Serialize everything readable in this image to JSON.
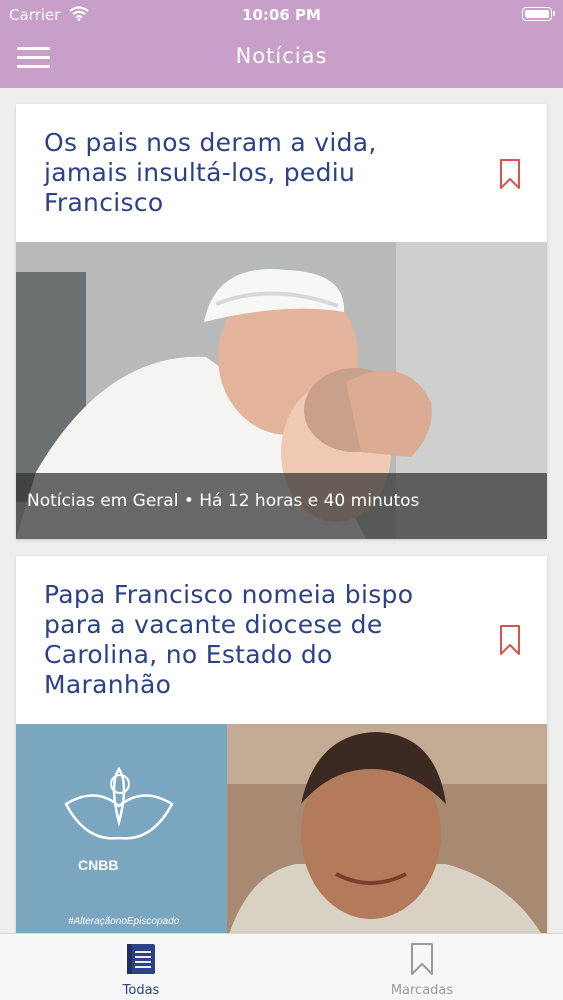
{
  "status_bar": {
    "carrier": "Carrier",
    "time": "10:06 PM",
    "icons": [
      "wifi-icon",
      "battery-icon"
    ]
  },
  "nav": {
    "title": "Notícias",
    "menu_icon": "hamburger-menu-icon"
  },
  "colors": {
    "nav_background": "#c79fc9",
    "title_text": "#2c4187",
    "bookmark": "#d9534f",
    "active_tab": "#2c4187"
  },
  "articles": [
    {
      "title": "Os pais nos deram a vida, jamais insultá-los, pediu Francisco",
      "meta": "Notícias em Geral • Há 12 horas e 40 minutos",
      "bookmark_icon": "bookmark-outline-icon"
    },
    {
      "title": "Papa Francisco nomeia bispo para a vacante diocese de Carolina, no Estado do Maranhão",
      "image_caption_logo": "CNBB",
      "image_hashtag": "#AlteraçãonoEpiscopado",
      "bookmark_icon": "bookmark-outline-icon"
    }
  ],
  "tabs": [
    {
      "label": "Todas",
      "icon": "document-list-icon",
      "active": true
    },
    {
      "label": "Marcadas",
      "icon": "bookmark-outline-icon",
      "active": false
    }
  ]
}
